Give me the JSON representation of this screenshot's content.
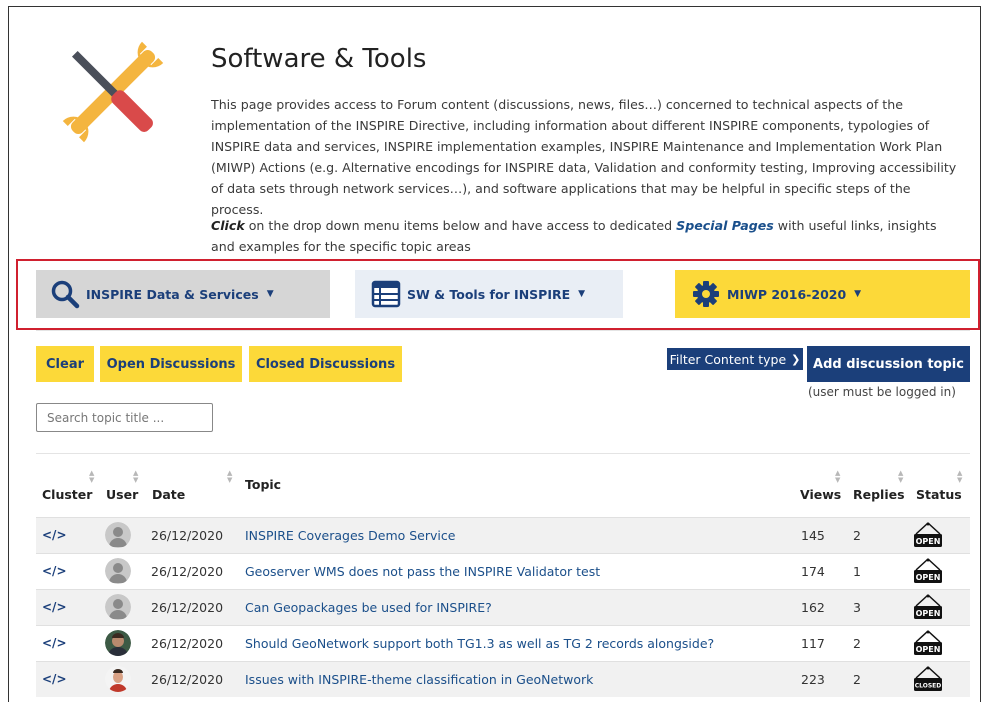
{
  "page": {
    "title": "Software & Tools",
    "description": "This page provides access to Forum content (discussions, news, files…) concerned to technical aspects of the implementation of the INSPIRE Directive, including information about different INSPIRE components, typologies of INSPIRE data and services, INSPIRE implementation examples, INSPIRE Maintenance and Implementation Work Plan (MIWP) Actions (e.g. Alternative encodings for INSPIRE data, Validation and conformity testing, Improving accessibility of data sets through network services…), and software applications that may be helpful in specific steps of the process.",
    "click_word": "Click",
    "click_text_1": " on the drop down menu items below and have access to dedicated ",
    "special_pages": "Special Pages",
    "click_text_2": " with useful links, insights and examples for the specific topic areas"
  },
  "menus": [
    {
      "label": "INSPIRE Data & Services",
      "icon": "search-icon",
      "color": "#d6d6d6"
    },
    {
      "label": "SW & Tools for INSPIRE",
      "icon": "table-icon",
      "color": "#e9eef5"
    },
    {
      "label": "MIWP 2016-2020",
      "icon": "gear-icon",
      "color": "#fcd939"
    }
  ],
  "toolbar": {
    "clear": "Clear",
    "open_discussions": "Open Discussions",
    "closed_discussions": "Closed Discussions",
    "filter": "Filter Content type",
    "add_topic": "Add discussion topic",
    "login_note": "(user must be logged in)"
  },
  "search": {
    "placeholder": "Search topic title ..."
  },
  "table": {
    "headers": {
      "cluster": "Cluster",
      "user": "User",
      "date": "Date",
      "topic": "Topic",
      "views": "Views",
      "replies": "Replies",
      "status": "Status"
    },
    "rows": [
      {
        "cluster": "</>",
        "avatar": "default",
        "date": "26/12/2020",
        "topic": "INSPIRE Coverages Demo Service",
        "views": "145",
        "replies": "2",
        "status": "OPEN"
      },
      {
        "cluster": "</>",
        "avatar": "default",
        "date": "26/12/2020",
        "topic": "Geoserver WMS does not pass the INSPIRE Validator test",
        "views": "174",
        "replies": "1",
        "status": "OPEN"
      },
      {
        "cluster": "</>",
        "avatar": "default",
        "date": "26/12/2020",
        "topic": "Can Geopackages be used for INSPIRE?",
        "views": "162",
        "replies": "3",
        "status": "OPEN"
      },
      {
        "cluster": "</>",
        "avatar": "photo1",
        "date": "26/12/2020",
        "topic": "Should GeoNetwork support both TG1.3 as well as TG 2 records alongside?",
        "views": "117",
        "replies": "2",
        "status": "OPEN"
      },
      {
        "cluster": "</>",
        "avatar": "photo2",
        "date": "26/12/2020",
        "topic": "Issues with INSPIRE-theme classification in GeoNetwork",
        "views": "223",
        "replies": "2",
        "status": "CLOSED"
      }
    ]
  },
  "colors": {
    "navy": "#1b3f7a",
    "yellow": "#fcd939",
    "highlight": "#d0202f"
  }
}
